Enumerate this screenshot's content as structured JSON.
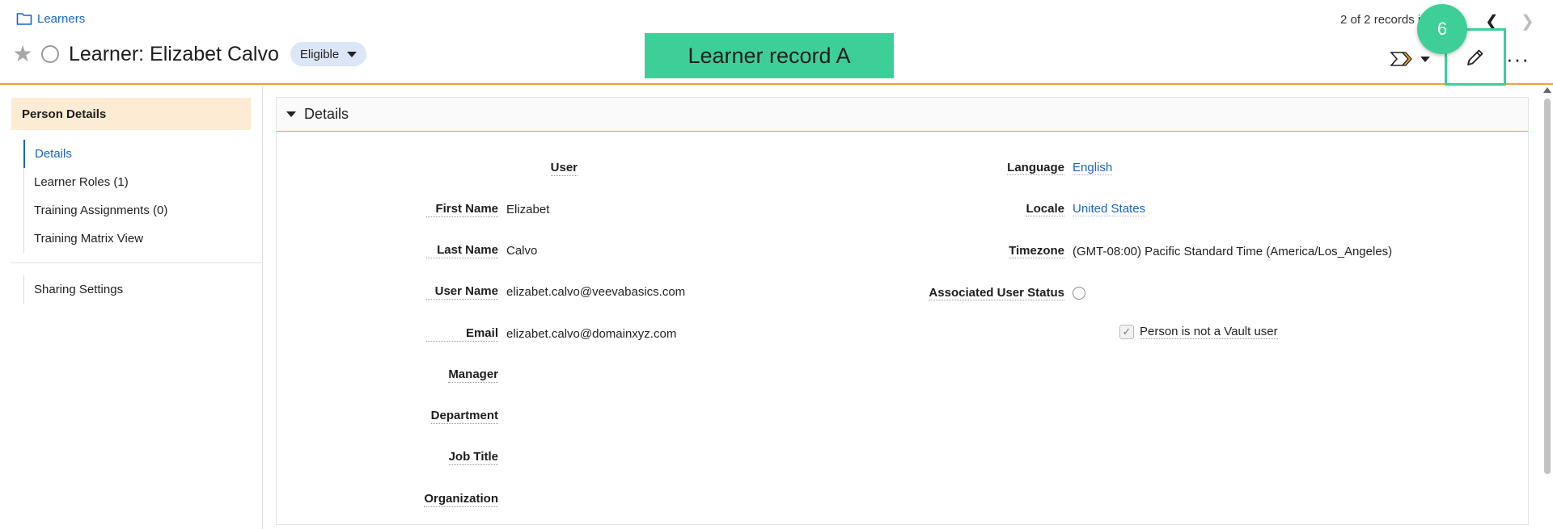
{
  "header": {
    "breadcrumb": "Learners",
    "title": "Learner: Elizabet Calvo",
    "status": "Eligible",
    "records_text": "2 of 2 records in list",
    "more_label": "···",
    "annotation_banner": "Learner record A",
    "step_badge": "6"
  },
  "sidebar": {
    "section_title": "Person Details",
    "items": [
      {
        "label": "Details"
      },
      {
        "label": "Learner Roles (1)"
      },
      {
        "label": "Training Assignments (0)"
      },
      {
        "label": "Training Matrix View"
      }
    ],
    "secondary_items": [
      {
        "label": "Sharing Settings"
      }
    ]
  },
  "details": {
    "section_title": "Details",
    "left_fields": [
      {
        "label": "User",
        "value": ""
      },
      {
        "label": "First Name",
        "value": "Elizabet"
      },
      {
        "label": "Last Name",
        "value": "Calvo"
      },
      {
        "label": "User Name",
        "value": "elizabet.calvo@veevabasics.com"
      },
      {
        "label": "Email",
        "value": "elizabet.calvo@domainxyz.com"
      },
      {
        "label": "Manager",
        "value": ""
      },
      {
        "label": "Department",
        "value": ""
      },
      {
        "label": "Job Title",
        "value": ""
      },
      {
        "label": "Organization",
        "value": ""
      }
    ],
    "right_fields": [
      {
        "label": "Language",
        "value": "English"
      },
      {
        "label": "Locale",
        "value": "United States"
      },
      {
        "label": "Timezone",
        "value": "(GMT-08:00) Pacific Standard Time (America/Los_Angeles)"
      },
      {
        "label": "Associated User Status",
        "value": ""
      }
    ],
    "checkbox_label": "Person is not a Vault user"
  },
  "colors": {
    "accent_orange": "#f0a035",
    "link_blue": "#1a65c7",
    "annotation_green": "#3ecf98",
    "section_bg": "#fdebd3",
    "status_pill_bg": "#dbe6f6"
  },
  "icons": [
    "folder-icon",
    "star-icon",
    "radio-circle-icon",
    "chevron-down-icon",
    "chevron-left-icon",
    "chevron-right-icon",
    "lifecycle-icon",
    "pencil-icon",
    "more-icon",
    "checkmark-icon"
  ]
}
